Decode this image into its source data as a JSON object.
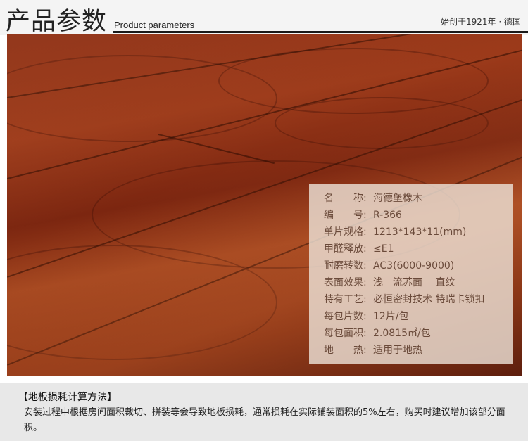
{
  "header": {
    "title_cn": "产品参数",
    "title_en": "Product parameters",
    "since": "始创于1921年 · 德国"
  },
  "specs": [
    {
      "label": "名　　称:",
      "value": "海德堡橡木"
    },
    {
      "label": "编　　号:",
      "value": "R-366"
    },
    {
      "label": "单片规格:",
      "value": "1213*143*11(mm)"
    },
    {
      "label": "甲醛释放:",
      "value": "≤E1"
    },
    {
      "label": "耐磨转数:",
      "value": "AC3(6000-9000)"
    },
    {
      "label": "表面效果:",
      "value": "浅　流苏面　 直纹"
    },
    {
      "label": "特有工艺:",
      "value": "必恒密封技术 特瑞卡锁扣"
    },
    {
      "label": "每包片数:",
      "value": "12片/包"
    },
    {
      "label": "每包面积:",
      "value": "2.0815㎡/包"
    },
    {
      "label": "地　　热:",
      "value": "适用于地热"
    }
  ],
  "bottom": {
    "title": "【地板损耗计算方法】",
    "text": "安装过程中根据房间面积裁切、拼装等会导致地板损耗，通常损耗在实际铺装面积的5%左右，购买时建议增加该部分面积。"
  }
}
